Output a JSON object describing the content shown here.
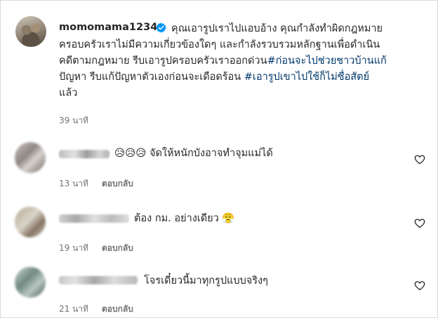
{
  "post": {
    "username": "momomama1234",
    "verified_icon": "verified-badge-icon",
    "caption_lines": [
      "คุณเอารูปเราไปแอบอ้าง คุณกำลังทำผิดกฎหมาย",
      "ครอบครัวเราไม่มีความเกี่ยวข้องใดๆ และกำลังรวบรวมหลักฐานเพื่อดำเนิน",
      "คดีตามกฎหมาย รีบเอารูปครอบครัวเราออกด่วน",
      "ปัญหา รีบแก้ปัญหาตัวเองก่อนจะเดือดร้อน",
      "แล้ว"
    ],
    "hashtags": [
      "#ก่อนจะไปช่วยชาวบ้านแก้",
      "#เอารูปเขาไปใช้ก็ไม่ซื่อสัตย์"
    ],
    "time": "39 นาที"
  },
  "comments": [
    {
      "text": "😥😥😥 จัดให้หนักบังอาจทำจุมแม่ได้",
      "time": "13 นาที",
      "reply": "ตอบกลับ"
    },
    {
      "text": "ต้อง กม. อย่างเดียว 😤",
      "time": "19 นาที",
      "reply": "ตอบกลับ"
    },
    {
      "text": "โจรเดี๋ยวนี้มาทุกรูปแบบจริงๆ",
      "time": "21 นาที",
      "reply": "ตอบกลับ"
    }
  ],
  "icons": {
    "like": "heart-outline-icon",
    "verified_color": "#0095f6"
  }
}
